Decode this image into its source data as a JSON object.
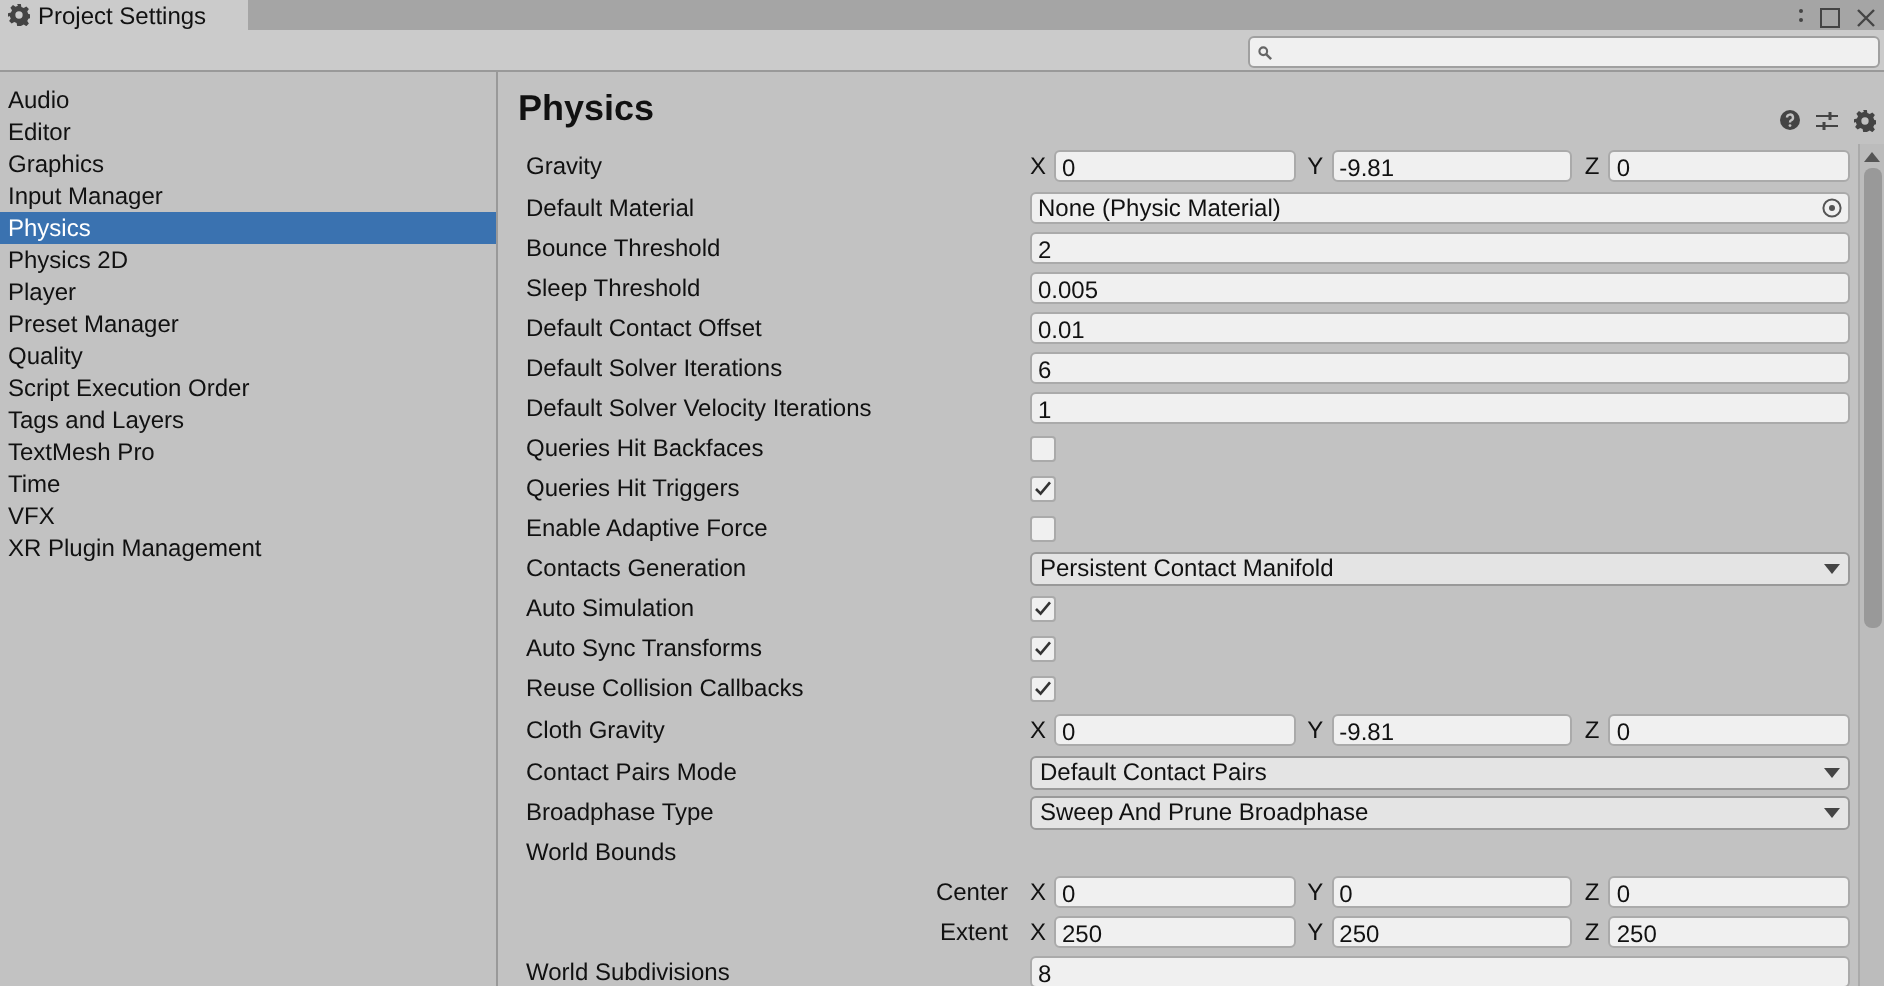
{
  "window": {
    "title": "Project Settings"
  },
  "sidebar": {
    "items": [
      {
        "label": "Audio",
        "selected": false
      },
      {
        "label": "Editor",
        "selected": false
      },
      {
        "label": "Graphics",
        "selected": false
      },
      {
        "label": "Input Manager",
        "selected": false
      },
      {
        "label": "Physics",
        "selected": true
      },
      {
        "label": "Physics 2D",
        "selected": false
      },
      {
        "label": "Player",
        "selected": false
      },
      {
        "label": "Preset Manager",
        "selected": false
      },
      {
        "label": "Quality",
        "selected": false
      },
      {
        "label": "Script Execution Order",
        "selected": false
      },
      {
        "label": "Tags and Layers",
        "selected": false
      },
      {
        "label": "TextMesh Pro",
        "selected": false
      },
      {
        "label": "Time",
        "selected": false
      },
      {
        "label": "VFX",
        "selected": false
      },
      {
        "label": "XR Plugin Management",
        "selected": false
      }
    ]
  },
  "panel": {
    "title": "Physics",
    "rows": [
      {
        "kind": "vector",
        "label": "Gravity",
        "components": [
          {
            "axis": "X",
            "value": "0"
          },
          {
            "axis": "Y",
            "value": "-9.81"
          },
          {
            "axis": "Z",
            "value": "0"
          }
        ]
      },
      {
        "kind": "object",
        "label": "Default Material",
        "value": "None (Physic Material)"
      },
      {
        "kind": "field",
        "label": "Bounce Threshold",
        "value": "2"
      },
      {
        "kind": "field",
        "label": "Sleep Threshold",
        "value": "0.005"
      },
      {
        "kind": "field",
        "label": "Default Contact Offset",
        "value": "0.01"
      },
      {
        "kind": "field",
        "label": "Default Solver Iterations",
        "value": "6"
      },
      {
        "kind": "field",
        "label": "Default Solver Velocity Iterations",
        "value": "1"
      },
      {
        "kind": "check",
        "label": "Queries Hit Backfaces",
        "checked": false
      },
      {
        "kind": "check",
        "label": "Queries Hit Triggers",
        "checked": true
      },
      {
        "kind": "check",
        "label": "Enable Adaptive Force",
        "checked": false
      },
      {
        "kind": "dropdown",
        "label": "Contacts Generation",
        "value": "Persistent Contact Manifold"
      },
      {
        "kind": "check",
        "label": "Auto Simulation",
        "checked": true
      },
      {
        "kind": "check",
        "label": "Auto Sync Transforms",
        "checked": true
      },
      {
        "kind": "check",
        "label": "Reuse Collision Callbacks",
        "checked": true
      },
      {
        "kind": "vector",
        "label": "Cloth Gravity",
        "components": [
          {
            "axis": "X",
            "value": "0"
          },
          {
            "axis": "Y",
            "value": "-9.81"
          },
          {
            "axis": "Z",
            "value": "0"
          }
        ]
      },
      {
        "kind": "dropdown",
        "label": "Contact Pairs Mode",
        "value": "Default Contact Pairs"
      },
      {
        "kind": "dropdown",
        "label": "Broadphase Type",
        "value": "Sweep And Prune Broadphase"
      },
      {
        "kind": "header",
        "label": "World Bounds"
      },
      {
        "kind": "subvector",
        "label": "Center",
        "components": [
          {
            "axis": "X",
            "value": "0"
          },
          {
            "axis": "Y",
            "value": "0"
          },
          {
            "axis": "Z",
            "value": "0"
          }
        ]
      },
      {
        "kind": "subvector",
        "label": "Extent",
        "components": [
          {
            "axis": "X",
            "value": "250"
          },
          {
            "axis": "Y",
            "value": "250"
          },
          {
            "axis": "Z",
            "value": "250"
          }
        ]
      },
      {
        "kind": "field",
        "label": "World Subdivisions",
        "value": "8"
      }
    ]
  }
}
